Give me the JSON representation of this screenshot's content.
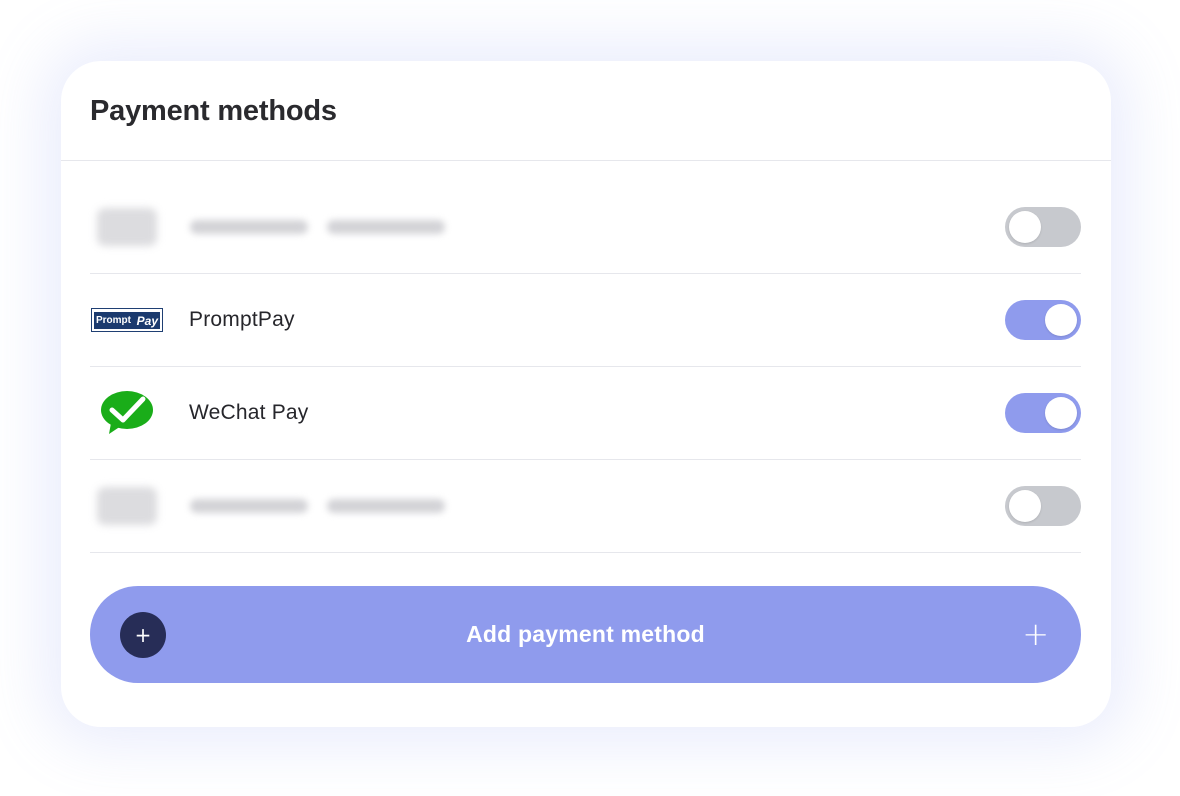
{
  "card": {
    "title": "Payment methods"
  },
  "methods": [
    {
      "name": "",
      "blurred": true,
      "enabled": false
    },
    {
      "name": "PromptPay",
      "logo": "promptpay-logo",
      "logo_text": {
        "prompt": "Prompt",
        "pay": "Pay"
      },
      "enabled": true
    },
    {
      "name": "WeChat Pay",
      "logo": "wechat-pay-icon",
      "enabled": true
    },
    {
      "name": "",
      "blurred": true,
      "enabled": false
    }
  ],
  "add_button": {
    "label": "Add payment method",
    "left_icon": "+",
    "right_icon": "+"
  },
  "colors": {
    "accent": "#8f9bed",
    "dark_circle": "#272d57",
    "toggle_off": "#c7c9ce",
    "wechat_green": "#1aad19"
  }
}
